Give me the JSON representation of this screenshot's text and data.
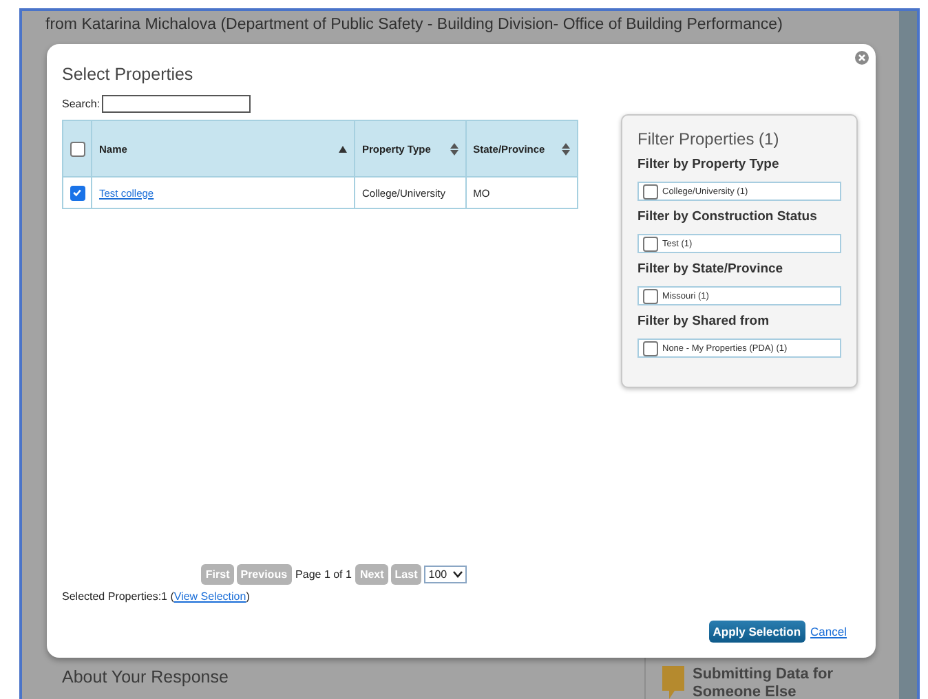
{
  "background": {
    "header": "from Katarina Michalova (Department of Public Safety - Building Division- Office of Building Performance)",
    "section_title": "About Your Response",
    "help_card": {
      "title": "Submitting Data for Someone Else"
    }
  },
  "dialog": {
    "title": "Select Properties",
    "search": {
      "label": "Search:"
    },
    "table": {
      "header_checked": false,
      "columns": [
        {
          "label": "Name",
          "sorted": true
        },
        {
          "label": "Property Type",
          "sorted": false
        },
        {
          "label": "State/Province",
          "sorted": false
        }
      ],
      "rows": [
        {
          "checked": true,
          "name": "Test college",
          "property_type": "College/University",
          "state": "MO"
        }
      ]
    },
    "filter": {
      "title": "Filter Properties (1)",
      "groups": [
        {
          "title": "Filter by Property Type",
          "options": [
            {
              "label": "College/University (1)",
              "checked": false
            }
          ]
        },
        {
          "title": "Filter by Construction Status",
          "options": [
            {
              "label": "Test (1)",
              "checked": false
            }
          ]
        },
        {
          "title": "Filter by State/Province",
          "options": [
            {
              "label": "Missouri (1)",
              "checked": false
            }
          ]
        },
        {
          "title": "Filter by Shared from",
          "options": [
            {
              "label": "None - My Properties (PDA) (1)",
              "checked": false
            }
          ]
        }
      ]
    },
    "pager": {
      "buttons": [
        {
          "label": "First",
          "disabled": true
        },
        {
          "label": "Previous",
          "disabled": true
        },
        {
          "label": "Next",
          "disabled": true
        },
        {
          "label": "Last",
          "disabled": true
        }
      ],
      "page_info": "Page 1 of 1",
      "page_size": "100"
    },
    "selected": {
      "prefix": "Selected Properties:1 (",
      "link": "View Selection",
      "suffix": ")"
    },
    "actions": {
      "apply": "Apply Selection",
      "cancel": "Cancel"
    }
  }
}
